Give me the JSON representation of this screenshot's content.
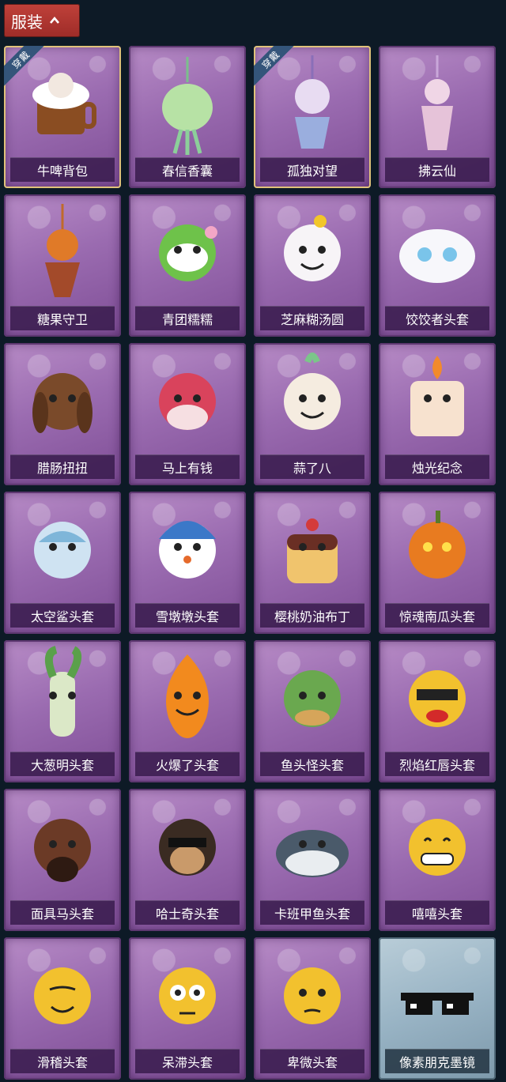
{
  "header": {
    "title": "服装"
  },
  "badge_text": "穿戴",
  "items": [
    {
      "name": "牛啤背包",
      "equipped": true,
      "icon": "beer-mug-backpack",
      "theme": "purple"
    },
    {
      "name": "春信香囊",
      "equipped": false,
      "icon": "sachet-pendant",
      "theme": "purple"
    },
    {
      "name": "孤独对望",
      "equipped": true,
      "icon": "doll-pendant",
      "theme": "purple"
    },
    {
      "name": "拂云仙",
      "equipped": false,
      "icon": "fairy-pendant",
      "theme": "purple"
    },
    {
      "name": "糖果守卫",
      "equipped": false,
      "icon": "pumpkin-scarecrow-pendant",
      "theme": "purple"
    },
    {
      "name": "青团糯糯",
      "equipped": false,
      "icon": "green-rice-ball-head",
      "theme": "purple"
    },
    {
      "name": "芝麻糊汤圆",
      "equipped": false,
      "icon": "dumpling-head",
      "theme": "purple"
    },
    {
      "name": "饺饺者头套",
      "equipped": false,
      "icon": "cloud-dumpling-head",
      "theme": "purple"
    },
    {
      "name": "腊肠扭扭",
      "equipped": false,
      "icon": "dog-head",
      "theme": "purple"
    },
    {
      "name": "马上有钱",
      "equipped": false,
      "icon": "horse-head",
      "theme": "purple"
    },
    {
      "name": "蒜了八",
      "equipped": false,
      "icon": "garlic-head",
      "theme": "purple"
    },
    {
      "name": "烛光纪念",
      "equipped": false,
      "icon": "candle-head",
      "theme": "purple"
    },
    {
      "name": "太空鲨头套",
      "equipped": false,
      "icon": "shark-head",
      "theme": "purple"
    },
    {
      "name": "雪墩墩头套",
      "equipped": false,
      "icon": "snowman-head",
      "theme": "purple"
    },
    {
      "name": "樱桃奶油布丁",
      "equipped": false,
      "icon": "pudding-head",
      "theme": "purple"
    },
    {
      "name": "惊魂南瓜头套",
      "equipped": false,
      "icon": "pumpkin-head",
      "theme": "purple"
    },
    {
      "name": "大葱明头套",
      "equipped": false,
      "icon": "scallion-head",
      "theme": "purple"
    },
    {
      "name": "火爆了头套",
      "equipped": false,
      "icon": "fire-head",
      "theme": "purple"
    },
    {
      "name": "鱼头怪头套",
      "equipped": false,
      "icon": "fish-head",
      "theme": "purple"
    },
    {
      "name": "烈焰红唇头套",
      "equipped": false,
      "icon": "yellow-lips-head",
      "theme": "purple"
    },
    {
      "name": "面具马头套",
      "equipped": false,
      "icon": "horse-mask-head",
      "theme": "purple"
    },
    {
      "name": "哈士奇头套",
      "equipped": false,
      "icon": "husky-head",
      "theme": "purple"
    },
    {
      "name": "卡班甲鱼头套",
      "equipped": false,
      "icon": "turtle-head",
      "theme": "purple"
    },
    {
      "name": "嘻嘻头套",
      "equipped": false,
      "icon": "grin-emoji-head",
      "theme": "purple"
    },
    {
      "name": "滑稽头套",
      "equipped": false,
      "icon": "smirk-emoji-head",
      "theme": "purple"
    },
    {
      "name": "呆滞头套",
      "equipped": false,
      "icon": "stunned-emoji-head",
      "theme": "purple"
    },
    {
      "name": "卑微头套",
      "equipped": false,
      "icon": "timid-emoji-head",
      "theme": "purple"
    },
    {
      "name": "像素朋克墨镜",
      "equipped": false,
      "icon": "pixel-sunglasses",
      "theme": "blue"
    }
  ]
}
